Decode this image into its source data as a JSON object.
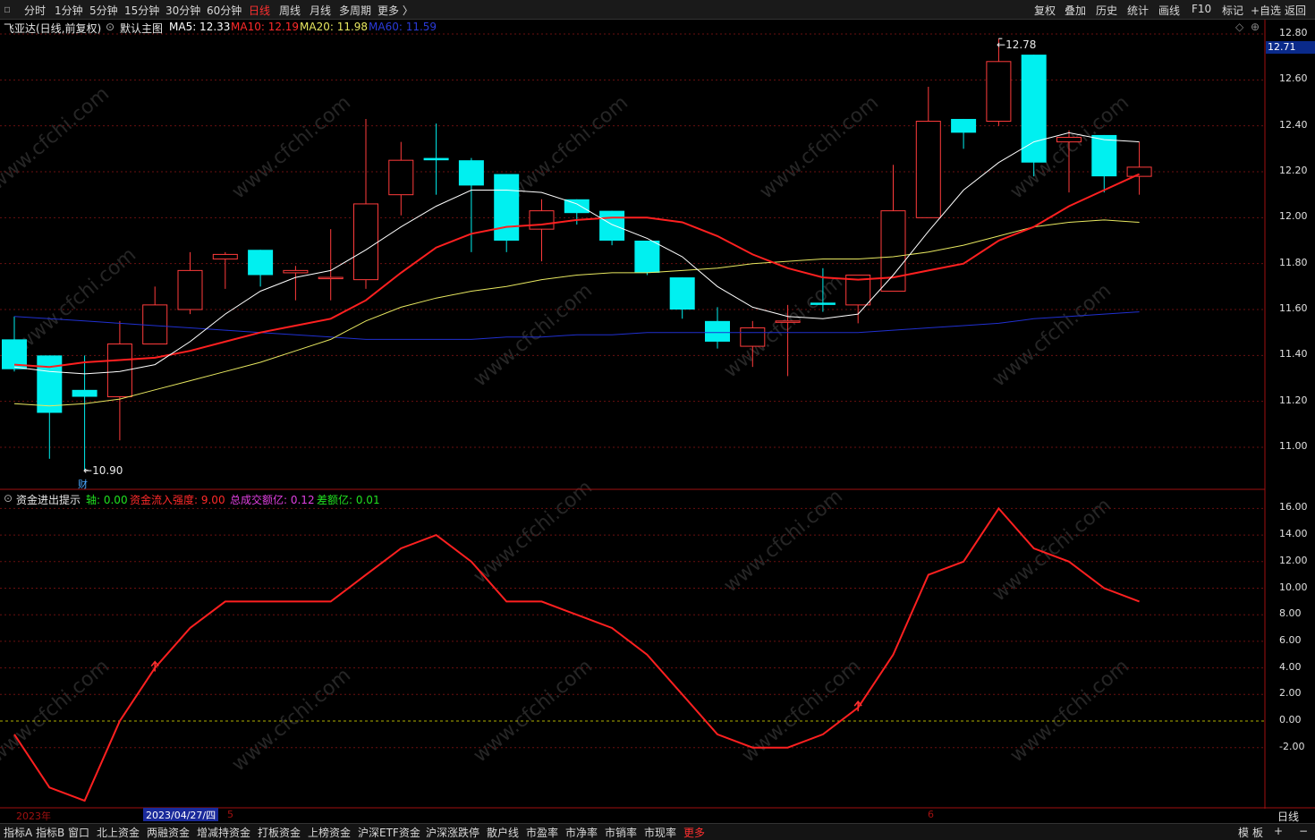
{
  "toolbar": {
    "periods": [
      "分时",
      "1分钟",
      "5分钟",
      "15分钟",
      "30分钟",
      "60分钟",
      "日线",
      "周线",
      "月线",
      "多周期",
      "更多 〉"
    ],
    "active_period": "日线",
    "right_buttons": [
      "复权",
      "叠加",
      "历史",
      "统计",
      "画线",
      "F10",
      "标记",
      "+自选",
      "返回"
    ]
  },
  "main_chart": {
    "stock_title": "飞亚达(日线,前复权)",
    "template": "默认主图",
    "ma5": "MA5: 12.33",
    "ma10": "MA10: 12.19",
    "ma20": "MA20: 11.98",
    "ma60": "MA60: 11.59",
    "current_price": "12.71",
    "high_marker": "12.78",
    "low_marker": "10.90",
    "fin_badge": "财",
    "price_axis": [
      "12.80",
      "12.60",
      "12.40",
      "12.20",
      "12.00",
      "11.80",
      "11.60",
      "11.40",
      "11.20",
      "11.00"
    ]
  },
  "indicator": {
    "name": "资金进出提示",
    "axis_label": "轴: 0.00",
    "strength": "资金流入强度: 9.00",
    "total_amount": "总成交额亿: 0.12",
    "diff_amount": "差额亿: 0.01",
    "axis_ticks": [
      "16.00",
      "14.00",
      "12.00",
      "10.00",
      "8.00",
      "6.00",
      "4.00",
      "2.00",
      "0.00",
      "-2.00"
    ]
  },
  "date_axis": {
    "year": "2023年",
    "cursor_date": "2023/04/27/四",
    "month_5": "5",
    "month_6": "6",
    "period_label": "日线"
  },
  "bottom_tabs": [
    "指标A",
    "指标B",
    "窗口",
    "北上资金",
    "两融资金",
    "增减持资金",
    "打板资金",
    "上榜资金",
    "沪深ETF资金",
    "沪深涨跌停",
    "散户线",
    "市盈率",
    "市净率",
    "市销率",
    "市现率",
    "更多"
  ],
  "bottom_right": [
    "模",
    "板",
    "+",
    "−"
  ],
  "watermark": "www.cfchi.com",
  "colors": {
    "up": "#ff3b3b",
    "down": "#00f0f0",
    "ma5": "#ffffff",
    "ma10": "#ff2020",
    "ma20": "#e8e860",
    "ma60": "#2030d0",
    "indicator_line": "#ff2020"
  },
  "chart_data": [
    {
      "type": "candlestick",
      "title": "飞亚达(日线,前复权)",
      "ylim": [
        10.8,
        12.85
      ],
      "candles": [
        {
          "o": 11.47,
          "h": 11.57,
          "l": 11.33,
          "c": 11.34
        },
        {
          "o": 11.4,
          "h": 11.4,
          "l": 10.95,
          "c": 11.15
        },
        {
          "o": 11.25,
          "h": 11.4,
          "l": 10.9,
          "c": 11.22
        },
        {
          "o": 11.22,
          "h": 11.55,
          "l": 11.03,
          "c": 11.45
        },
        {
          "o": 11.45,
          "h": 11.7,
          "l": 11.45,
          "c": 11.62
        },
        {
          "o": 11.6,
          "h": 11.85,
          "l": 11.58,
          "c": 11.77
        },
        {
          "o": 11.82,
          "h": 11.85,
          "l": 11.69,
          "c": 11.84
        },
        {
          "o": 11.86,
          "h": 11.86,
          "l": 11.7,
          "c": 11.75
        },
        {
          "o": 11.76,
          "h": 11.79,
          "l": 11.64,
          "c": 11.77
        },
        {
          "o": 11.74,
          "h": 11.95,
          "l": 11.64,
          "c": 11.74
        },
        {
          "o": 11.73,
          "h": 12.43,
          "l": 11.69,
          "c": 12.06
        },
        {
          "o": 12.1,
          "h": 12.33,
          "l": 12.01,
          "c": 12.25
        },
        {
          "o": 12.26,
          "h": 12.41,
          "l": 12.1,
          "c": 12.25
        },
        {
          "o": 12.25,
          "h": 12.26,
          "l": 11.85,
          "c": 12.14
        },
        {
          "o": 12.19,
          "h": 12.19,
          "l": 11.85,
          "c": 11.9
        },
        {
          "o": 11.95,
          "h": 12.08,
          "l": 11.81,
          "c": 12.03
        },
        {
          "o": 12.08,
          "h": 12.08,
          "l": 11.97,
          "c": 12.02
        },
        {
          "o": 12.03,
          "h": 12.03,
          "l": 11.88,
          "c": 11.9
        },
        {
          "o": 11.9,
          "h": 11.9,
          "l": 11.75,
          "c": 11.76
        },
        {
          "o": 11.74,
          "h": 11.74,
          "l": 11.56,
          "c": 11.6
        },
        {
          "o": 11.55,
          "h": 11.61,
          "l": 11.43,
          "c": 11.46
        },
        {
          "o": 11.44,
          "h": 11.55,
          "l": 11.35,
          "c": 11.52
        },
        {
          "o": 11.55,
          "h": 11.62,
          "l": 11.31,
          "c": 11.55
        },
        {
          "o": 11.63,
          "h": 11.78,
          "l": 11.59,
          "c": 11.62
        },
        {
          "o": 11.62,
          "h": 11.75,
          "l": 11.54,
          "c": 11.75
        },
        {
          "o": 11.68,
          "h": 12.23,
          "l": 11.68,
          "c": 12.03
        },
        {
          "o": 12.0,
          "h": 12.57,
          "l": 12.0,
          "c": 12.42
        },
        {
          "o": 12.43,
          "h": 12.43,
          "l": 12.3,
          "c": 12.37
        },
        {
          "o": 12.42,
          "h": 12.78,
          "l": 12.4,
          "c": 12.68
        },
        {
          "o": 12.71,
          "h": 12.71,
          "l": 12.18,
          "c": 12.24
        },
        {
          "o": 12.33,
          "h": 12.38,
          "l": 12.11,
          "c": 12.35
        },
        {
          "o": 12.36,
          "h": 12.36,
          "l": 12.11,
          "c": 12.18
        },
        {
          "o": 12.18,
          "h": 12.33,
          "l": 12.1,
          "c": 12.22
        }
      ],
      "ma5": [
        11.35,
        11.33,
        11.32,
        11.33,
        11.36,
        11.46,
        11.58,
        11.68,
        11.74,
        11.77,
        11.86,
        11.96,
        12.05,
        12.12,
        12.12,
        12.11,
        12.06,
        11.97,
        11.91,
        11.83,
        11.7,
        11.61,
        11.57,
        11.56,
        11.58,
        11.75,
        11.94,
        12.12,
        12.24,
        12.33,
        12.37,
        12.34,
        12.33
      ],
      "ma10": [
        11.36,
        11.35,
        11.37,
        11.38,
        11.39,
        11.42,
        11.46,
        11.5,
        11.53,
        11.56,
        11.64,
        11.76,
        11.87,
        11.93,
        11.96,
        11.97,
        11.99,
        12.0,
        12.0,
        11.98,
        11.92,
        11.84,
        11.78,
        11.74,
        11.73,
        11.74,
        11.77,
        11.8,
        11.9,
        11.96,
        12.05,
        12.12,
        12.19
      ],
      "ma20": [
        11.19,
        11.18,
        11.19,
        11.21,
        11.25,
        11.29,
        11.33,
        11.37,
        11.42,
        11.47,
        11.55,
        11.61,
        11.65,
        11.68,
        11.7,
        11.73,
        11.75,
        11.76,
        11.76,
        11.77,
        11.78,
        11.8,
        11.81,
        11.82,
        11.82,
        11.83,
        11.85,
        11.88,
        11.92,
        11.96,
        11.98,
        11.99,
        11.98
      ],
      "ma60": [
        11.57,
        11.56,
        11.55,
        11.54,
        11.53,
        11.52,
        11.51,
        11.5,
        11.49,
        11.48,
        11.47,
        11.47,
        11.47,
        11.47,
        11.48,
        11.48,
        11.49,
        11.49,
        11.5,
        11.5,
        11.5,
        11.5,
        11.5,
        11.5,
        11.5,
        11.51,
        11.52,
        11.53,
        11.54,
        11.56,
        11.57,
        11.58,
        11.59
      ]
    },
    {
      "type": "line",
      "title": "资金进出提示",
      "ylim": [
        -6.5,
        17.5
      ],
      "series": [
        {
          "name": "资金流入强度",
          "values": [
            -1,
            -5,
            -6,
            0,
            4,
            7,
            9,
            9,
            9,
            9,
            11,
            13,
            14,
            12,
            9,
            9,
            8,
            7,
            5,
            2,
            -1,
            -2,
            -2,
            -1,
            1,
            5,
            11,
            12,
            16,
            13,
            12,
            10,
            9
          ]
        }
      ],
      "buy_signals": [
        4,
        24
      ]
    }
  ]
}
